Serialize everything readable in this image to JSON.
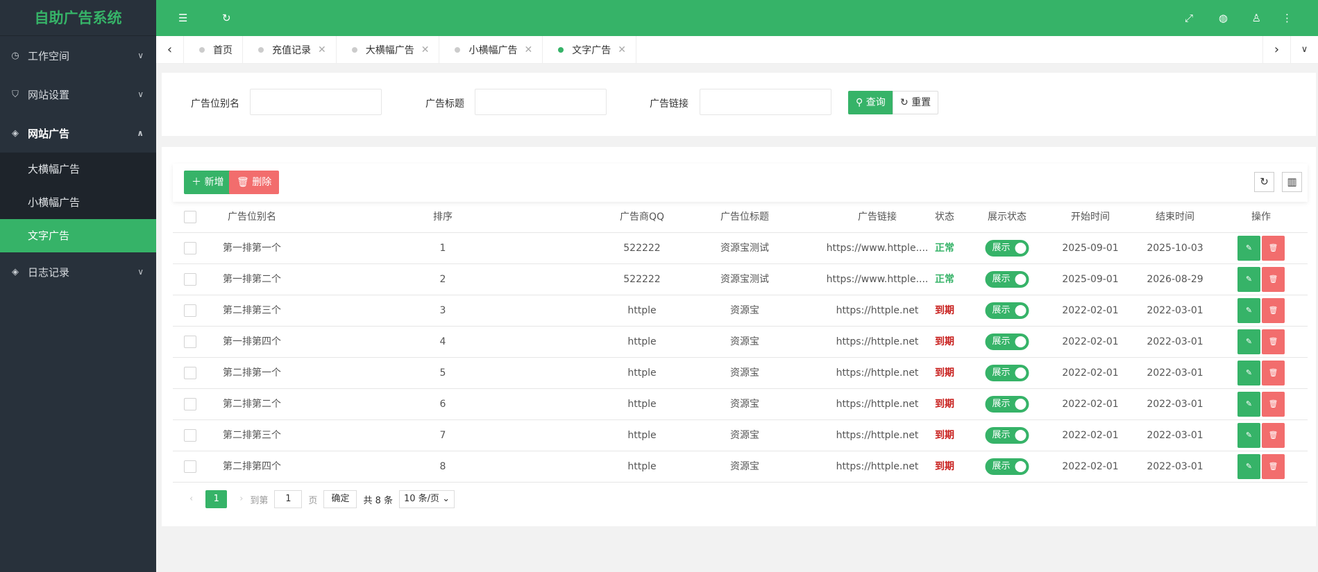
{
  "app": {
    "title": "自助广告系统"
  },
  "sidebar": {
    "items": [
      {
        "label": "工作空间",
        "icon": "dashboard-icon"
      },
      {
        "label": "网站设置",
        "icon": "shield-icon"
      },
      {
        "label": "网站广告",
        "icon": "layers-icon",
        "sub": [
          {
            "label": "大横幅广告"
          },
          {
            "label": "小横幅广告"
          },
          {
            "label": "文字广告",
            "active": true
          }
        ]
      },
      {
        "label": "日志记录",
        "icon": "layers-icon"
      }
    ]
  },
  "tabs": [
    {
      "label": "首页"
    },
    {
      "label": "充值记录"
    },
    {
      "label": "大横幅广告"
    },
    {
      "label": "小横幅广告"
    },
    {
      "label": "文字广告",
      "active": true
    }
  ],
  "search": {
    "fields": [
      {
        "label": "广告位别名",
        "value": ""
      },
      {
        "label": "广告标题",
        "value": ""
      },
      {
        "label": "广告链接",
        "value": ""
      }
    ],
    "query_label": "查询",
    "reset_label": "重置"
  },
  "toolbar": {
    "add_label": "新增",
    "delete_label": "删除"
  },
  "table": {
    "columns": [
      "广告位别名",
      "排序",
      "广告商QQ",
      "广告位标题",
      "广告链接",
      "状态",
      "展示状态",
      "开始时间",
      "结束时间",
      "操作"
    ],
    "rows": [
      [
        "第一排第一个",
        "1",
        "522222",
        "资源宝测试",
        "https://www.httple....",
        "正常",
        "展示",
        "2025-09-01",
        "2025-10-03"
      ],
      [
        "第一排第二个",
        "2",
        "522222",
        "资源宝测试",
        "https://www.httple....",
        "正常",
        "展示",
        "2025-09-01",
        "2026-08-29"
      ],
      [
        "第二排第三个",
        "3",
        "httple",
        "资源宝",
        "https://httple.net",
        "到期",
        "展示",
        "2022-02-01",
        "2022-03-01"
      ],
      [
        "第一排第四个",
        "4",
        "httple",
        "资源宝",
        "https://httple.net",
        "到期",
        "展示",
        "2022-02-01",
        "2022-03-01"
      ],
      [
        "第二排第一个",
        "5",
        "httple",
        "资源宝",
        "https://httple.net",
        "到期",
        "展示",
        "2022-02-01",
        "2022-03-01"
      ],
      [
        "第二排第二个",
        "6",
        "httple",
        "资源宝",
        "https://httple.net",
        "到期",
        "展示",
        "2022-02-01",
        "2022-03-01"
      ],
      [
        "第二排第三个",
        "7",
        "httple",
        "资源宝",
        "https://httple.net",
        "到期",
        "展示",
        "2022-02-01",
        "2022-03-01"
      ],
      [
        "第二排第四个",
        "8",
        "httple",
        "资源宝",
        "https://httple.net",
        "到期",
        "展示",
        "2022-02-01",
        "2022-03-01"
      ]
    ]
  },
  "pagination": {
    "current": "1",
    "goto_label": "到第",
    "page_value": "1",
    "page_suffix": "页",
    "confirm_label": "确定",
    "total_label": "共 8 条",
    "page_size": "10 条/页"
  },
  "colors": {
    "accent": "#36b368",
    "danger": "#f26d6d",
    "expired": "#c8201e",
    "sidebar": "#28313b"
  }
}
